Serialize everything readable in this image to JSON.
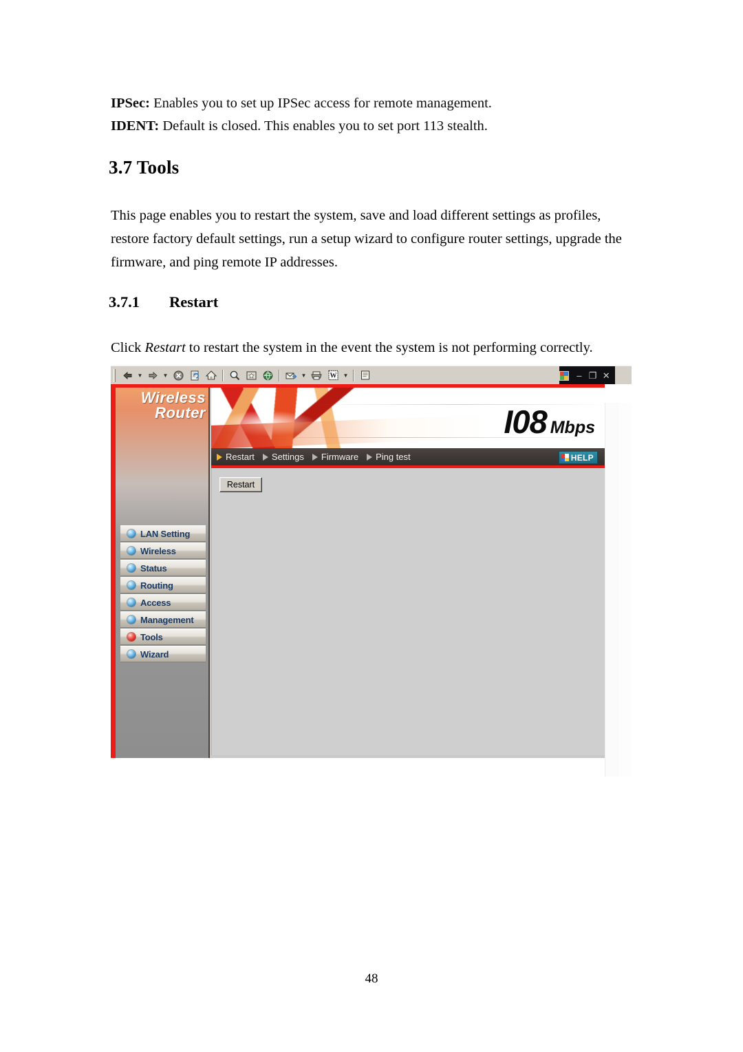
{
  "document": {
    "intro": [
      {
        "term": "IPSec:",
        "text": " Enables you to set up IPSec access for remote management."
      },
      {
        "term": "IDENT:",
        "text": " Default is closed.    This enables you to set port 113 stealth."
      }
    ],
    "section_heading": "3.7 Tools",
    "section_body": "This page enables you to restart the system, save and load different settings as profiles, restore factory default settings, run a setup wizard to configure router settings, upgrade the firmware, and ping remote IP addresses.",
    "subsection_number": "3.7.1",
    "subsection_title": "Restart",
    "caption_before": "Click ",
    "caption_italic": "Restart",
    "caption_after": " to restart the system in the event the system is not performing correctly.",
    "page_number": "48"
  },
  "screenshot": {
    "browser_toolbar": {
      "buttons": [
        {
          "name": "back-icon",
          "label": "Back"
        },
        {
          "name": "back-dropdown-icon",
          "label": "Back history"
        },
        {
          "name": "forward-icon",
          "label": "Forward"
        },
        {
          "name": "forward-dropdown-icon",
          "label": "Forward history"
        },
        {
          "name": "stop-icon",
          "label": "Stop"
        },
        {
          "name": "refresh-icon",
          "label": "Refresh"
        },
        {
          "name": "home-icon",
          "label": "Home"
        },
        {
          "name": "search-icon",
          "label": "Search"
        },
        {
          "name": "favorites-icon",
          "label": "Favorites"
        },
        {
          "name": "history-icon",
          "label": "History"
        },
        {
          "name": "mail-icon",
          "label": "Mail"
        },
        {
          "name": "mail-dropdown-icon",
          "label": "Mail menu"
        },
        {
          "name": "print-icon",
          "label": "Print"
        },
        {
          "name": "edit-word-icon",
          "label": "Edit with Word"
        },
        {
          "name": "edit-dropdown-icon",
          "label": "Edit menu"
        },
        {
          "name": "discuss-icon",
          "label": "Discuss"
        }
      ]
    },
    "window_controls": {
      "minimize": "–",
      "restore": "❐",
      "close": "✕"
    },
    "router": {
      "brand_line1": "Wireless",
      "brand_line2": "Router",
      "banner_number": "I08",
      "banner_unit": "Mbps",
      "nav_tabs": [
        {
          "label": "Restart",
          "active": true
        },
        {
          "label": "Settings",
          "active": false
        },
        {
          "label": "Firmware",
          "active": false
        },
        {
          "label": "Ping test",
          "active": false
        }
      ],
      "help_label": "HELP",
      "sidebar_items": [
        {
          "label": "LAN Setting",
          "active": false
        },
        {
          "label": "Wireless",
          "active": false
        },
        {
          "label": "Status",
          "active": false
        },
        {
          "label": "Routing",
          "active": false
        },
        {
          "label": "Access",
          "active": false
        },
        {
          "label": "Management",
          "active": false
        },
        {
          "label": "Tools",
          "active": true
        },
        {
          "label": "Wizard",
          "active": false
        }
      ],
      "restart_button_label": "Restart"
    },
    "colors": {
      "accent_red": "#ec1c17",
      "nav_bar": "#3e3835",
      "content_bg": "#cfcfcf",
      "sidebar_text": "#1c3b63",
      "help_bg": "#1d6f88",
      "active_bullet": "#d81a10",
      "inactive_bullet": "#2f86bf"
    }
  }
}
